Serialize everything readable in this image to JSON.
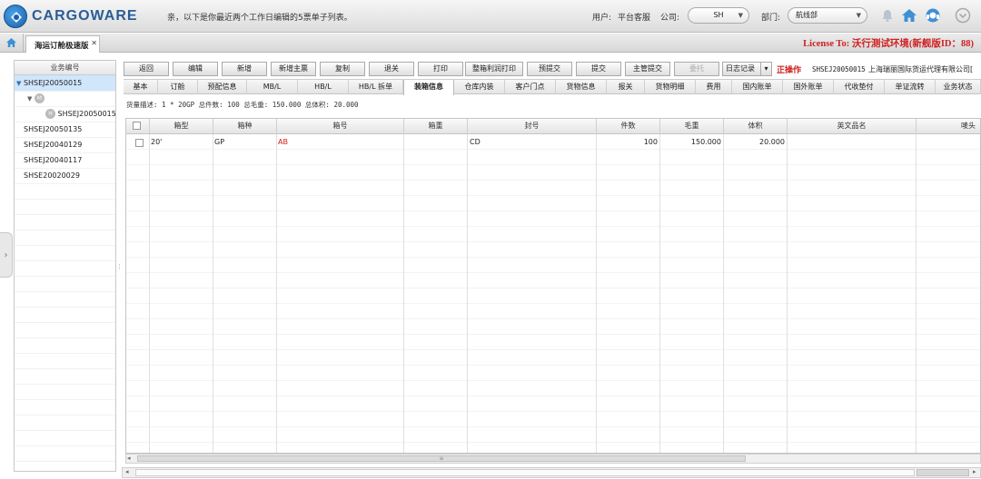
{
  "header": {
    "brand": "CARGOWARE",
    "greeting": "亲，以下是你最近两个工作日编辑的5票单子列表。",
    "user_label": "用户:",
    "user_value": "平台客服",
    "company_label": "公司:",
    "company_value": "SH",
    "dept_label": "部门:",
    "dept_value": "航线部",
    "icons": [
      "bell-icon",
      "home-icon",
      "support-icon",
      "dropdown-circle-icon"
    ]
  },
  "tabbar": {
    "active_tab": "海运订舱极速版",
    "close_glyph": "✕",
    "license": "License To: 沃行测试环境(新舰版ID：88)"
  },
  "sidebar": {
    "header": "业务编号",
    "rows": [
      {
        "label": "SHSEJ20050015",
        "expander": "▼",
        "selected": true
      },
      {
        "label": "",
        "expander": "▼",
        "badge": "M"
      },
      {
        "label": "SHSEJ20050015",
        "badge": "H"
      },
      {
        "label": "SHSEJ20050135"
      },
      {
        "label": "SHSEJ20040129"
      },
      {
        "label": "SHSEJ20040117"
      },
      {
        "label": "SHSE20020029"
      }
    ],
    "handle_glyph": "›",
    "splitter_glyph": "⋮"
  },
  "toolbar": {
    "buttons": [
      {
        "label": "返回",
        "enabled": true
      },
      {
        "label": "编辑",
        "enabled": true
      },
      {
        "label": "新增",
        "enabled": true
      },
      {
        "label": "新增主票",
        "enabled": true
      },
      {
        "label": "复制",
        "enabled": true
      },
      {
        "label": "退关",
        "enabled": true
      },
      {
        "label": "打印",
        "enabled": true
      },
      {
        "label": "整箱利润打印",
        "enabled": true
      },
      {
        "label": "预提交",
        "enabled": true
      },
      {
        "label": "提交",
        "enabled": true
      },
      {
        "label": "主管提交",
        "enabled": true
      },
      {
        "label": "委托",
        "enabled": false
      }
    ],
    "log_select": "日志记录",
    "status_label": "正操作",
    "ref_no": "SHSEJ20050015",
    "company_name": "上海瑞丽国际货运代理有限公司[",
    "select_arrow": "▾"
  },
  "subtabs": [
    "基本",
    "订舱",
    "预配信息",
    "MB/L",
    "HB/L",
    "HB/L 拆单",
    "装箱信息",
    "仓库内装",
    "客户门点",
    "货物信息",
    "报关",
    "货物明细",
    "费用",
    "国内账单",
    "国外账单",
    "代收垫付",
    "单证流转",
    "业务状态"
  ],
  "active_subtab": "装箱信息",
  "summary": "货量描述: 1 * 20GP 总件数: 100 总毛重: 150.000 总体积: 20.000",
  "grid": {
    "columns": [
      "",
      "箱型",
      "箱种",
      "箱号",
      "箱重",
      "封号",
      "件数",
      "毛重",
      "体积",
      "英文品名",
      "唛头"
    ],
    "rows": [
      {
        "type": "20'",
        "kind": "GP",
        "box_no": "AB",
        "box_weight": "",
        "seal": "CD",
        "pieces": "100",
        "gross": "150.000",
        "volume": "20.000",
        "en_name": "",
        "marks": ""
      }
    ],
    "accent_box_no": "#d02020"
  },
  "scrollbar": {
    "grip": "≡",
    "left": "◂",
    "right": "▸"
  },
  "colors": {
    "brand": "#2a5d97",
    "license": "#d02020",
    "selected_row": "#cfe6fb"
  }
}
